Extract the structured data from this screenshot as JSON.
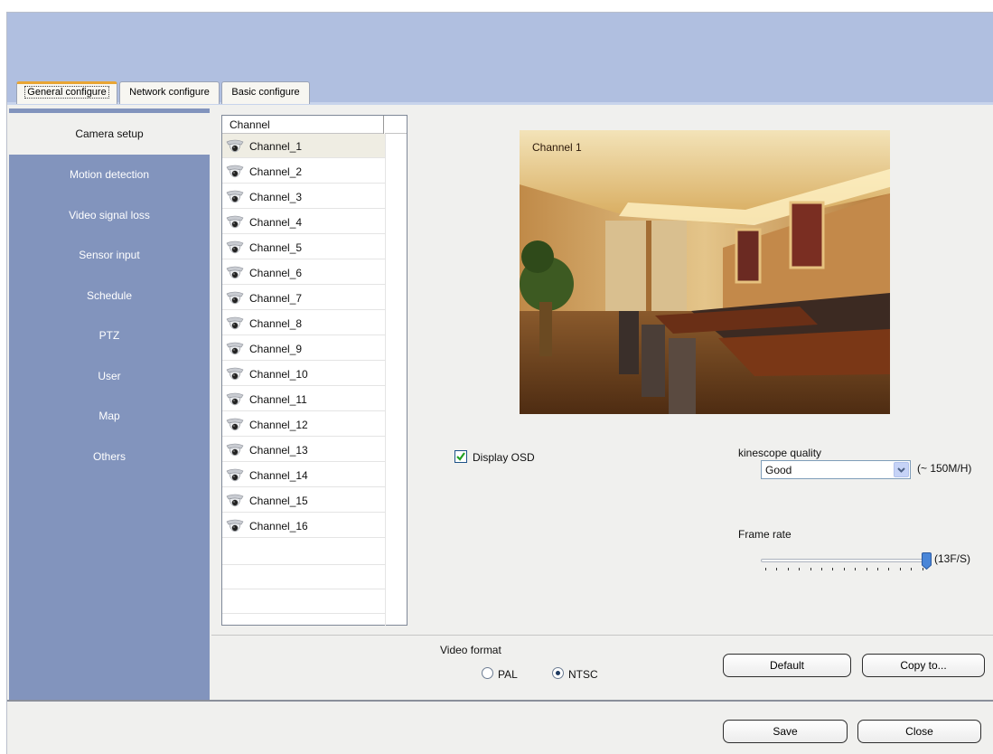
{
  "tabs": [
    {
      "label": "General configure",
      "active": true
    },
    {
      "label": "Network configure",
      "active": false
    },
    {
      "label": "Basic configure",
      "active": false
    }
  ],
  "sidebar": {
    "items": [
      {
        "label": "Camera setup",
        "selected": true
      },
      {
        "label": "Motion detection"
      },
      {
        "label": "Video signal loss"
      },
      {
        "label": "Sensor input"
      },
      {
        "label": "Schedule"
      },
      {
        "label": "PTZ"
      },
      {
        "label": "User"
      },
      {
        "label": "Map"
      },
      {
        "label": "Others"
      }
    ]
  },
  "channels": {
    "header": "Channel",
    "selected": "Channel_1",
    "items": [
      "Channel_1",
      "Channel_2",
      "Channel_3",
      "Channel_4",
      "Channel_5",
      "Channel_6",
      "Channel_7",
      "Channel_8",
      "Channel_9",
      "Channel_10",
      "Channel_11",
      "Channel_12",
      "Channel_13",
      "Channel_14",
      "Channel_15",
      "Channel_16"
    ]
  },
  "preview": {
    "osd_text": "Channel 1"
  },
  "osd": {
    "label": "Display OSD",
    "checked": true
  },
  "kinescope": {
    "label": "kinescope quality",
    "value": "Good",
    "size": "(~ 150M/H)"
  },
  "frame_rate": {
    "label": "Frame rate",
    "value_text": "(13F/S)",
    "position_fraction": 1.0
  },
  "video_format": {
    "label": "Video format",
    "options": [
      {
        "label": "PAL",
        "selected": false
      },
      {
        "label": "NTSC",
        "selected": true
      }
    ]
  },
  "buttons": {
    "default": "Default",
    "copy_to": "Copy to...",
    "save": "Save",
    "close": "Close"
  },
  "colors": {
    "banner": "#b0bfe0",
    "sidebar": "#8294bd",
    "tab_accent": "#e8a534"
  },
  "icons": {
    "channel": "dome-camera-icon",
    "checkbox": "checkmark-icon",
    "dropdown": "chevron-down-icon"
  }
}
